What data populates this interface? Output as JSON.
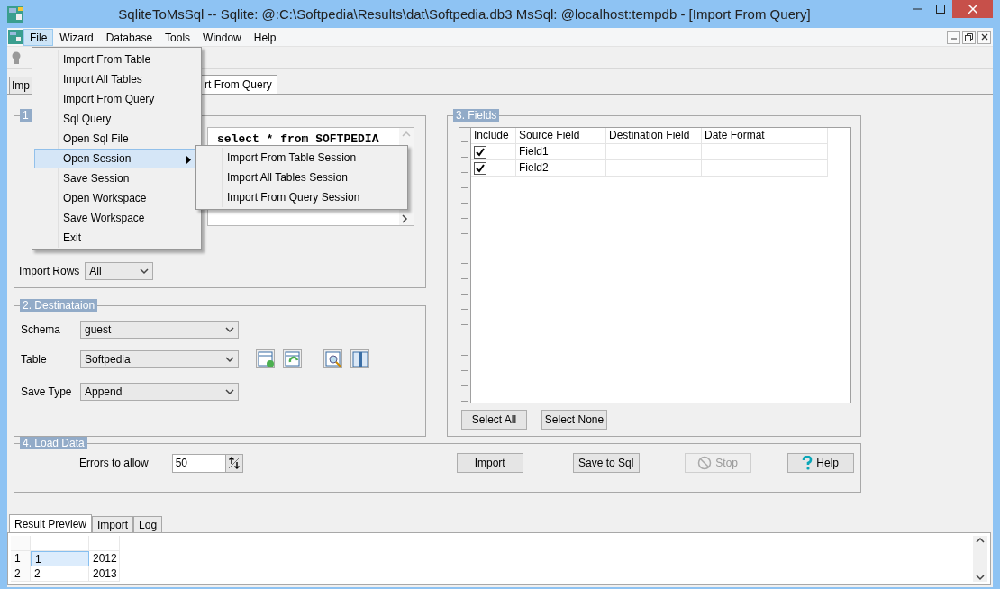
{
  "window": {
    "title": "SqliteToMsSql -- Sqlite: @:C:\\Softpedia\\Results\\dat\\Softpedia.db3 MsSql: @localhost:tempdb - [Import From Query]"
  },
  "menu_bar": [
    {
      "label": "File",
      "selected": true
    },
    {
      "label": "Wizard",
      "selected": false
    },
    {
      "label": "Database",
      "selected": false
    },
    {
      "label": "Tools",
      "selected": false
    },
    {
      "label": "Window",
      "selected": false
    },
    {
      "label": "Help",
      "selected": false
    }
  ],
  "file_menu": [
    {
      "label": "Import From Table",
      "selected": false,
      "submenu": false
    },
    {
      "label": "Import All Tables",
      "selected": false,
      "submenu": false
    },
    {
      "label": "Import From Query",
      "selected": false,
      "submenu": false
    },
    {
      "label": "Sql Query",
      "selected": false,
      "submenu": false
    },
    {
      "label": "Open Sql File",
      "selected": false,
      "submenu": false
    },
    {
      "label": "Open Session",
      "selected": true,
      "submenu": true
    },
    {
      "label": "Save Session",
      "selected": false,
      "submenu": false
    },
    {
      "label": "Open Workspace",
      "selected": false,
      "submenu": false
    },
    {
      "label": "Save Workspace",
      "selected": false,
      "submenu": false
    },
    {
      "label": "Exit",
      "selected": false,
      "submenu": false
    }
  ],
  "session_submenu": [
    {
      "label": "Import From Table Session"
    },
    {
      "label": "Import All Tables Session"
    },
    {
      "label": "Import From Query Session"
    }
  ],
  "tabs": [
    {
      "label": "Imp",
      "selected": false
    },
    {
      "label": "rt From Query",
      "selected": true
    }
  ],
  "source": {
    "legend": "1",
    "query": "select * from SOFTPEDIA",
    "import_rows_label": "Import Rows",
    "import_rows_value": "All"
  },
  "destination": {
    "legend": "2. Destinataion",
    "fields": [
      {
        "label": "Schema",
        "value": "guest"
      },
      {
        "label": "Table",
        "value": "Softpedia"
      },
      {
        "label": "Save Type",
        "value": "Append"
      }
    ]
  },
  "fields": {
    "legend": "3. Fields",
    "columns": [
      "Include",
      "Source Field",
      "Destination Field",
      "Date Format"
    ],
    "rows": [
      {
        "include": true,
        "source": "Field1"
      },
      {
        "include": true,
        "source": "Field2"
      }
    ],
    "buttons": [
      "Select All",
      "Select None"
    ]
  },
  "load_data": {
    "legend": "4. Load Data",
    "errors_label": "Errors to allow",
    "errors_value": "50",
    "buttons": [
      {
        "label": "Import",
        "kind": "plain",
        "disabled": false
      },
      {
        "label": "Save to Sql",
        "kind": "plain",
        "disabled": false
      },
      {
        "label": "Stop",
        "kind": "stop",
        "disabled": true
      },
      {
        "label": "Help",
        "kind": "help",
        "disabled": false
      }
    ]
  },
  "bottom_tabs": [
    {
      "label": "Result Preview",
      "selected": true
    },
    {
      "label": "Import",
      "selected": false
    },
    {
      "label": "Log",
      "selected": false
    }
  ],
  "result_grid": {
    "rows": [
      {
        "number": "1",
        "cells": [
          "1",
          "2012"
        ],
        "selected": true
      },
      {
        "number": "2",
        "cells": [
          "2",
          "2013"
        ],
        "selected": false
      }
    ]
  }
}
